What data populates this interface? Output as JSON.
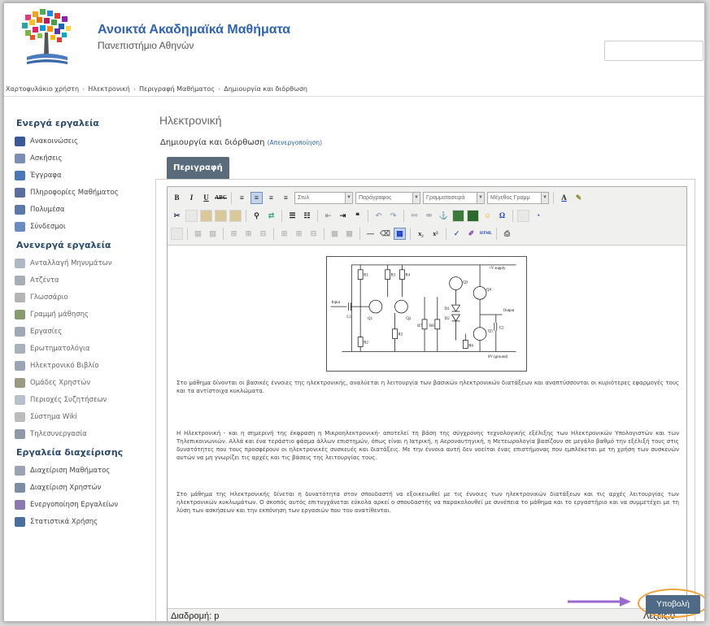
{
  "site": {
    "title": "Ανοικτά Ακαδημαϊκά Μαθήματα",
    "subtitle": "Πανεπιστήμιο Αθηνών"
  },
  "breadcrumb": [
    "Χαρτοφυλάκιο χρήστη",
    "Ηλεκτρονική",
    "Περιγραφή Μαθήματος",
    "Δημιουργία και διόρθωση"
  ],
  "sidebar": {
    "active_title": "Ενεργά εργαλεία",
    "active": [
      {
        "label": "Ανακοινώσεις",
        "icon": "announcements-icon",
        "color": "#3b5998"
      },
      {
        "label": "Ασκήσεις",
        "icon": "exercises-icon",
        "color": "#7a8fb0"
      },
      {
        "label": "Έγγραφα",
        "icon": "documents-icon",
        "color": "#4a78b6"
      },
      {
        "label": "Πληροφορίες Μαθήματος",
        "icon": "course-info-icon",
        "color": "#5b6ea0"
      },
      {
        "label": "Πολυμέσα",
        "icon": "multimedia-icon",
        "color": "#5a78a8"
      },
      {
        "label": "Σύνδεσμοι",
        "icon": "links-icon",
        "color": "#6a8cc0"
      }
    ],
    "inactive_title": "Ανενεργά εργαλεία",
    "inactive": [
      {
        "label": "Ανταλλαγή Μηνυμάτων",
        "icon": "messages-icon",
        "color": "#b0b8c4"
      },
      {
        "label": "Ατζέντα",
        "icon": "agenda-icon",
        "color": "#a8aeb8"
      },
      {
        "label": "Γλωσσάριο",
        "icon": "glossary-icon",
        "color": "#b5b5b5"
      },
      {
        "label": "Γραμμή μάθησης",
        "icon": "learning-path-icon",
        "color": "#8a9a70"
      },
      {
        "label": "Εργασίες",
        "icon": "assignments-icon",
        "color": "#a0a8b8"
      },
      {
        "label": "Ερωτηματολόγια",
        "icon": "questionnaire-icon",
        "color": "#a8b0bc"
      },
      {
        "label": "Ηλεκτρονικό Βιβλίο",
        "icon": "ebook-icon",
        "color": "#9aa6b8"
      },
      {
        "label": "Ομάδες Χρηστών",
        "icon": "groups-icon",
        "color": "#9a9a80"
      },
      {
        "label": "Περιοχές Συζητήσεων",
        "icon": "forum-icon",
        "color": "#b8c0cc"
      },
      {
        "label": "Σύστημα Wiki",
        "icon": "wiki-icon",
        "color": "#bcbcbc"
      },
      {
        "label": "Τηλεσυνεργασία",
        "icon": "conference-icon",
        "color": "#8e9aa8"
      }
    ],
    "admin_title": "Εργαλεία διαχείρισης",
    "admin": [
      {
        "label": "Διαχείριση Μαθήματος",
        "icon": "course-admin-icon",
        "color": "#9aa4b2"
      },
      {
        "label": "Διαχείριση Χρηστών",
        "icon": "user-admin-icon",
        "color": "#7a8ea8"
      },
      {
        "label": "Ενεργοποίηση Εργαλείων",
        "icon": "tools-icon",
        "color": "#8a7ab0"
      },
      {
        "label": "Στατιστικά Χρήσης",
        "icon": "stats-icon",
        "color": "#4a6ea0"
      }
    ]
  },
  "main": {
    "course": "Ηλεκτρονική",
    "action": "Δημιουργία και διόρθωση",
    "action_note": "(Απενεργοποίηση)",
    "tab": "Περιγραφή"
  },
  "toolbar": {
    "style": "Στυλ",
    "format": "Παράγραφος",
    "font": "Γραμματοσειρά",
    "size": "Μέγεθος Γραμμ"
  },
  "circuit_labels": [
    "R1",
    "R3",
    "R4",
    "+V supply",
    "Q3",
    "Q4",
    "Input",
    "C1",
    "Q1",
    "Q2",
    "D1",
    "D2",
    "R7",
    "R8",
    "Output",
    "Q5",
    "C2",
    "R2",
    "R5",
    "R6",
    "0V (ground)"
  ],
  "paragraphs": [
    "Στο μάθημα δίνονται οι βασικές έννοιες της ηλεκτρονικής, αναλύεται η λειτουργία των βασικών ηλεκτρονικών διατάξεων και αναπτύσσονται οι κυριότερες εφαρμογές τους και τα αντίστοιχα κυκλώματα.",
    "Η Ηλεκτρονική - και η σημερινή της έκφραση η Μικροηλεκτρονική- αποτελεί τη βάση της σύγχρονης τεχνολογικής εξέλιξης των Ηλεκτρονικών Υπολογιστών και των Τηλεπικοινωνιών. Αλλά και ένα τεράστιο φάσμα άλλων επιστημών, όπως είναι η Ιατρική, η Αεροναυτηγική, η Μετεωρολογία βασίζουν σε μεγάλο βαθμό την εξέλιξή τους στις δυνατότητες που τους προσφέρουν οι ηλεκτρονικές συσκευές και διατάξεις. Με την έννοια αυτή δεν νοείται ένας επιστήμονας που εμπλέκεται με τη χρήση των συσκευών αυτών να μη γνωρίζει τις αρχές και τις βάσεις της λειτουργίας τους.",
    "Στο μάθημα της Ηλεκτρονικής δίνεται η δυνατότητα στον σπουδαστή να εξοικειωθεί με τις έννοιες των ηλεκτρονικών διατάξεων και τις αρχές λειτουργίας των ηλεκτρονικών κυκλωμάτων. Ο σκοπός αυτός επιτυγχάνεται εύκολα αρκεί ο σπουδαστής να παρακολουθεί με συνέπεια το μάθημα και το εργαστήριο και να συμμετέχει με τη λύση των ασκήσεων και την εκπόνηση των εργασιών που του ανατίθενται."
  ],
  "status": {
    "path": "Διαδρομή: p",
    "words": "Λέξεις:0"
  },
  "submit_label": "Υποβολή",
  "colors": {
    "brand_blue": "#2d62b8",
    "tab": "#5a6b7c",
    "submit": "#4e6a86",
    "highlight": "#f2a136",
    "arrow": "#9b6ad0"
  }
}
